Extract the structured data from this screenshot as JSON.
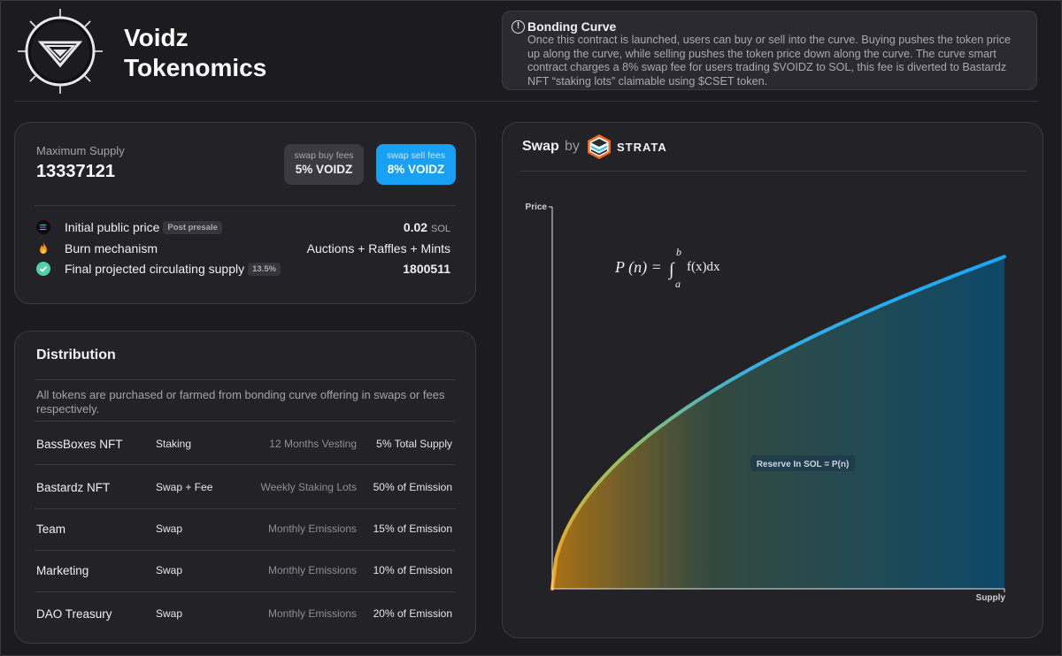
{
  "header": {
    "title_line1": "Voidz",
    "title_line2": "Tokenomics"
  },
  "notice": {
    "icon": "info-icon",
    "title": "Bonding Curve",
    "body": "Once this contract is launched, users can buy or sell into the curve. Buying pushes the token price up along the curve, while selling pushes the token price down along the curve. The curve smart contract charges a 8% swap fee for users trading $VOIDZ to SOL, this fee is diverted to Bastardz NFT “staking lots” claimable using $CSET token."
  },
  "supply": {
    "label": "Maximum Supply",
    "value": "13337121",
    "buy_fee_label": "swap buy fees",
    "buy_fee_value": "5% VOIDZ",
    "sell_fee_label": "swap sell fees",
    "sell_fee_value": "8% VOIDZ",
    "rows": [
      {
        "icon": "solana-icon",
        "label": "Initial public price",
        "tag": "Post presale",
        "value": "0.02",
        "unit": "SOL"
      },
      {
        "icon": "fire-icon",
        "label": "Burn mechanism",
        "tag": "",
        "value": "Auctions + Raffles + Mints",
        "unit": ""
      },
      {
        "icon": "check-circle-icon",
        "label": "Final projected circulating supply",
        "tag": "13.5%",
        "value": "1800511",
        "unit": ""
      }
    ]
  },
  "distribution": {
    "title": "Distribution",
    "description": "All tokens are purchased or farmed from bonding curve offering in swaps or fees respectively.",
    "rows": [
      {
        "name": "BassBoxes NFT",
        "source": "Staking",
        "schedule": "12 Months Vesting",
        "share": "5% Total Supply"
      },
      {
        "name": "Bastardz NFT",
        "source": "Swap + Fee",
        "schedule": "Weekly Staking Lots",
        "share": "50% of Emission"
      },
      {
        "name": "Team",
        "source": "Swap",
        "schedule": "Monthly Emissions",
        "share": "15% of Emission"
      },
      {
        "name": "Marketing",
        "source": "Swap",
        "schedule": "Monthly Emissions",
        "share": "10% of Emission"
      },
      {
        "name": "DAO Treasury",
        "source": "Swap",
        "schedule": "Monthly Emissions",
        "share": "20% of Emission"
      }
    ]
  },
  "swap": {
    "title": "Swap",
    "by": "by",
    "provider": "STRATA",
    "provider_icon": "strata-icon"
  },
  "colors": {
    "background": "#1c1c20",
    "panel": "#222227",
    "accent_blue": "#18a0f5",
    "curve_start": "#f5a623",
    "curve_end": "#1aa7f7"
  },
  "chart_data": {
    "type": "area",
    "ylabel": "Price",
    "xlabel": "Supply",
    "formula": {
      "lhs": "P (n) = ",
      "integral": "∫",
      "upper": "b",
      "lower": "a",
      "integrand": "f(x)dx"
    },
    "annotation": "Reserve In SOL = P(n)",
    "curve": "sqrt",
    "x": [
      0,
      0.1,
      0.2,
      0.3,
      0.4,
      0.5,
      0.6,
      0.7,
      0.8,
      0.9,
      1.0
    ],
    "y": [
      0,
      0.316,
      0.447,
      0.548,
      0.632,
      0.707,
      0.775,
      0.837,
      0.894,
      0.949,
      1.0
    ],
    "xlim": [
      0,
      1
    ],
    "ylim": [
      0,
      1.15
    ],
    "grid": false
  }
}
